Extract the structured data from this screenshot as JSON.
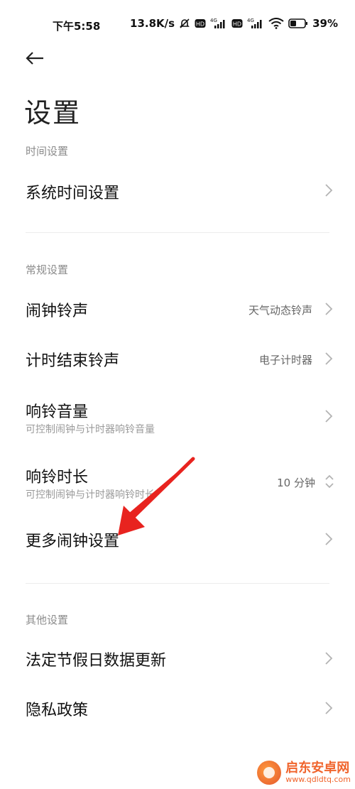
{
  "status_bar": {
    "time": "下午5:58",
    "net_speed": "13.8K/s",
    "battery": "39%",
    "icons": [
      "mute-icon",
      "hd-icon",
      "4g-signal-icon",
      "hd-icon",
      "4g-signal-icon",
      "wifi-icon",
      "battery-icon"
    ]
  },
  "header": {
    "back_icon": "back-arrow-icon",
    "title": "设置"
  },
  "sections": {
    "time": {
      "header": "时间设置",
      "items": [
        {
          "title": "系统时间设置"
        }
      ]
    },
    "general": {
      "header": "常规设置",
      "items": [
        {
          "title": "闹钟铃声",
          "value": "天气动态铃声"
        },
        {
          "title": "计时结束铃声",
          "value": "电子计时器"
        },
        {
          "title": "响铃音量",
          "subtitle": "可控制闹钟与计时器响铃音量"
        },
        {
          "title": "响铃时长",
          "subtitle": "可控制闹钟与计时器响铃时长",
          "value": "10 分钟"
        },
        {
          "title": "更多闹钟设置"
        }
      ]
    },
    "other": {
      "header": "其他设置",
      "items": [
        {
          "title": "法定节假日数据更新"
        },
        {
          "title": "隐私政策"
        }
      ]
    }
  },
  "annotation": {
    "arrow_color": "#e8231f"
  },
  "watermark": {
    "name": "启东安卓网",
    "url": "www.qdldtq.com"
  },
  "colors": {
    "accent": "#e8231f",
    "section_header": "#8b8b8b",
    "divider": "#ececec"
  }
}
